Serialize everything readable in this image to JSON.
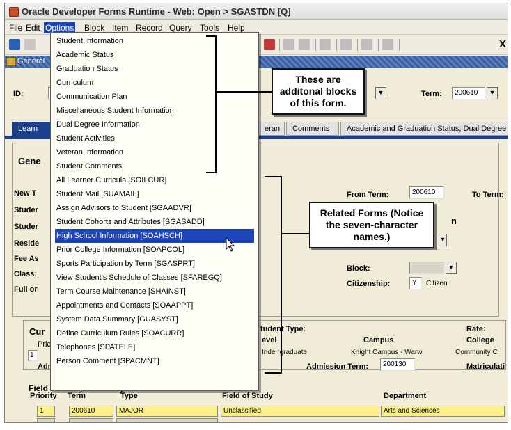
{
  "window": {
    "title": "Oracle Developer Forms Runtime - Web:  Open > SGASTDN [Q]"
  },
  "menubar": [
    "File",
    "Edit",
    "Options",
    "Block",
    "Item",
    "Record",
    "Query",
    "Tools",
    "Help"
  ],
  "toolbar": {
    "exit_label": "X"
  },
  "form": {
    "header_title": "General",
    "id_label": "ID:",
    "term_label": "Term:",
    "term_value": "200610"
  },
  "tabs": [
    "Learn",
    "eran",
    "Comments",
    "Academic and Graduation Status, Dual Degree"
  ],
  "general": {
    "section_title": "Gene",
    "left_labels": [
      "New T",
      "Studer",
      "Studer",
      "Reside",
      "Fee As",
      "Class:",
      "Full or"
    ],
    "from_term_label": "From Term:",
    "from_term_value": "200610",
    "to_term_label": "To Term:",
    "partial_label": "n",
    "block_label": "Block:",
    "citizenship_label": "Citizenship:",
    "citizenship_code": "Y",
    "citizenship_text": "Citizen"
  },
  "curriculum": {
    "title": "Cur",
    "priority_label": "Pric",
    "priority_value": "1",
    "adm_label": "Adm",
    "student_type_label": "tudent Type:",
    "level_label": "evel",
    "level_value": "Inde rgraduate",
    "campus_label": "Campus",
    "campus_value": "Knight Campus - Warw",
    "rate_label": "Rate:",
    "college_label": "College",
    "college_value": "Community C",
    "admission_term_label": "Admission Term:",
    "admission_term_value": "200130",
    "matriculation_label": "Matriculati"
  },
  "field_of_study": {
    "title": "Field of Study Summary",
    "columns": [
      "Priority",
      "Term",
      "Type",
      "Field of Study",
      "Department"
    ],
    "row": {
      "priority": "1",
      "term": "200610",
      "type": "MAJOR",
      "field": "Unclassified",
      "department": "Arts and Sciences"
    }
  },
  "options_menu": {
    "block_items": [
      "Student Information",
      "Academic Status",
      "Graduation Status",
      "Curriculum",
      "Communication Plan",
      "Miscellaneous Student Information",
      "Dual Degree Information",
      "Student Activities",
      "Veteran Information",
      "Student Comments"
    ],
    "form_items": [
      "All Learner Curricula [SOILCUR]",
      "Student Mail [SUAMAIL]",
      "Assign Advisors to Student [SGAADVR]",
      "Student Cohorts and Attributes [SGASADD]",
      "High School Information [SOAHSCH]",
      "Prior College Information [SOAPCOL]",
      "Sports Participation by Term [SGASPRT]",
      "View Student's Schedule of Classes [SFAREGQ]",
      "Term Course Maintenance [SHAINST]",
      "Appointments and Contacts [SOAAPPT]",
      "System Data Summary [GUASYST]",
      "Define Curriculum Rules [SOACURR]",
      "Telephones [SPATELE]",
      "Person Comment [SPACMNT]"
    ],
    "highlighted_item": "High School Information [SOAHSCH]"
  },
  "callouts": {
    "blocks": "These are additonal blocks of this form.",
    "forms": "Related Forms (Notice the seven-character names.)"
  },
  "colors": {
    "menu_highlight": "#1d44b8",
    "field_yellow": "#fbf08a",
    "tab_active": "#1c3f8c",
    "form_background": "#f1ecd7"
  },
  "icons": [
    "oracle-forms-icon",
    "save-icon",
    "exit-icon",
    "mouse-pointer-icon",
    "form-header-icon"
  ]
}
